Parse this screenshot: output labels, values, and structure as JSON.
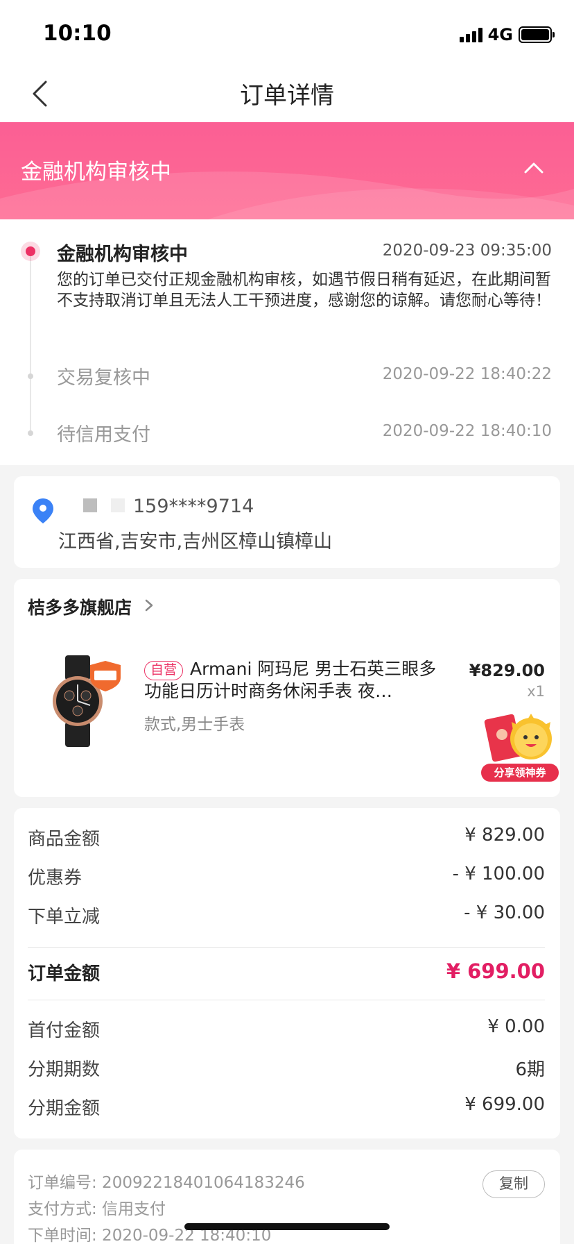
{
  "status_bar": {
    "time": "10:10",
    "network": "4G"
  },
  "nav": {
    "title": "订单详情"
  },
  "banner": {
    "title": "金融机构审核中"
  },
  "timeline": [
    {
      "title": "金融机构审核中",
      "time": "2020-09-23 09:35:00",
      "desc": "您的订单已交付正规金融机构审核，如遇节假日稍有延迟，在此期间暂不支持取消订单且无法人工干预进度，感谢您的谅解。请您耐心等待！"
    },
    {
      "title": "交易复核中",
      "time": "2020-09-22 18:40:22"
    },
    {
      "title": "待信用支付",
      "time": "2020-09-22 18:40:10"
    }
  ],
  "address": {
    "phone": "159****9714",
    "address": "江西省,吉安市,吉州区樟山镇樟山"
  },
  "shop": {
    "name": "桔多多旗舰店",
    "product": {
      "tag": "自营",
      "title": "Armani 阿玛尼 男士石英三眼多功能日历计时商务休闲手表 夜…",
      "spec": "款式,男士手表",
      "price": "¥829.00",
      "qty": "x1",
      "share_label": "分享领神券"
    }
  },
  "amounts": {
    "goods": {
      "label": "商品金额",
      "value": "¥ 829.00"
    },
    "coupon": {
      "label": "优惠券",
      "value": "- ¥ 100.00"
    },
    "discount": {
      "label": "下单立减",
      "value": "- ¥ 30.00"
    },
    "total": {
      "label": "订单金额",
      "value": "¥ 699.00"
    },
    "down_payment": {
      "label": "首付金额",
      "value": "¥ 0.00"
    },
    "periods": {
      "label": "分期期数",
      "value": "6期"
    },
    "installment": {
      "label": "分期金额",
      "value": "¥ 699.00"
    }
  },
  "order_info": {
    "order_no": "订单编号: 20092218401064183246",
    "payment": "支付方式: 信用支付",
    "order_time": "下单时间: 2020-09-22 18:40:10",
    "copy_label": "复制"
  },
  "colors": {
    "accent": "#ec3164",
    "banner": "#fb5f94",
    "price": "#e21e63"
  }
}
